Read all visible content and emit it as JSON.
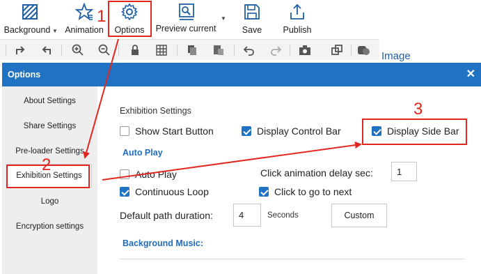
{
  "ribbon": {
    "background_label": "Background",
    "animation_label": "Animation",
    "options_label": "Options",
    "preview_label": "Preview current",
    "save_label": "Save",
    "publish_label": "Publish"
  },
  "toolbar": {
    "icons": [
      "redo-arrow-icon",
      "undo-arrow-icon",
      "zoom-in-icon",
      "zoom-out-icon",
      "lock-icon",
      "grid-icon",
      "copy-icon",
      "paste-icon",
      "undo-icon",
      "redo-icon",
      "camera-icon",
      "group-icon",
      "shape-icon"
    ]
  },
  "side_panel": {
    "image_label": "Image"
  },
  "dialog": {
    "title": "Options",
    "nav": [
      "About Settings",
      "Share Settings",
      "Pre-loader Settings",
      "Exhibition Settings",
      "Logo",
      "Encryption settings"
    ],
    "selected_nav": "Exhibition Settings",
    "exhibition_heading": "Exhibition Settings",
    "show_start_button": {
      "label": "Show Start Button",
      "checked": false
    },
    "display_control_bar": {
      "label": "Display Control Bar",
      "checked": true
    },
    "display_side_bar": {
      "label": "Display Side Bar",
      "checked": true
    },
    "auto_play_heading": "Auto Play",
    "auto_play": {
      "label": "Auto Play",
      "checked": false
    },
    "continuous_loop": {
      "label": "Continuous Loop",
      "checked": true
    },
    "click_to_go_next": {
      "label": "Click to go to next",
      "checked": true
    },
    "click_delay_label": "Click animation delay sec:",
    "click_delay_value": "1",
    "path_duration_label": "Default path duration:",
    "path_duration_value": "4",
    "seconds_label": "Seconds",
    "custom_label": "Custom",
    "background_music_heading": "Background Music:"
  },
  "annotations": {
    "step_1": "1",
    "step_2": "2",
    "step_3": "3",
    "color": "#e0261f"
  },
  "colors": {
    "dialog_header": "#1f73c2",
    "heading_blue": "#1f6cbf",
    "checkbox_blue": "#1f73c2"
  }
}
